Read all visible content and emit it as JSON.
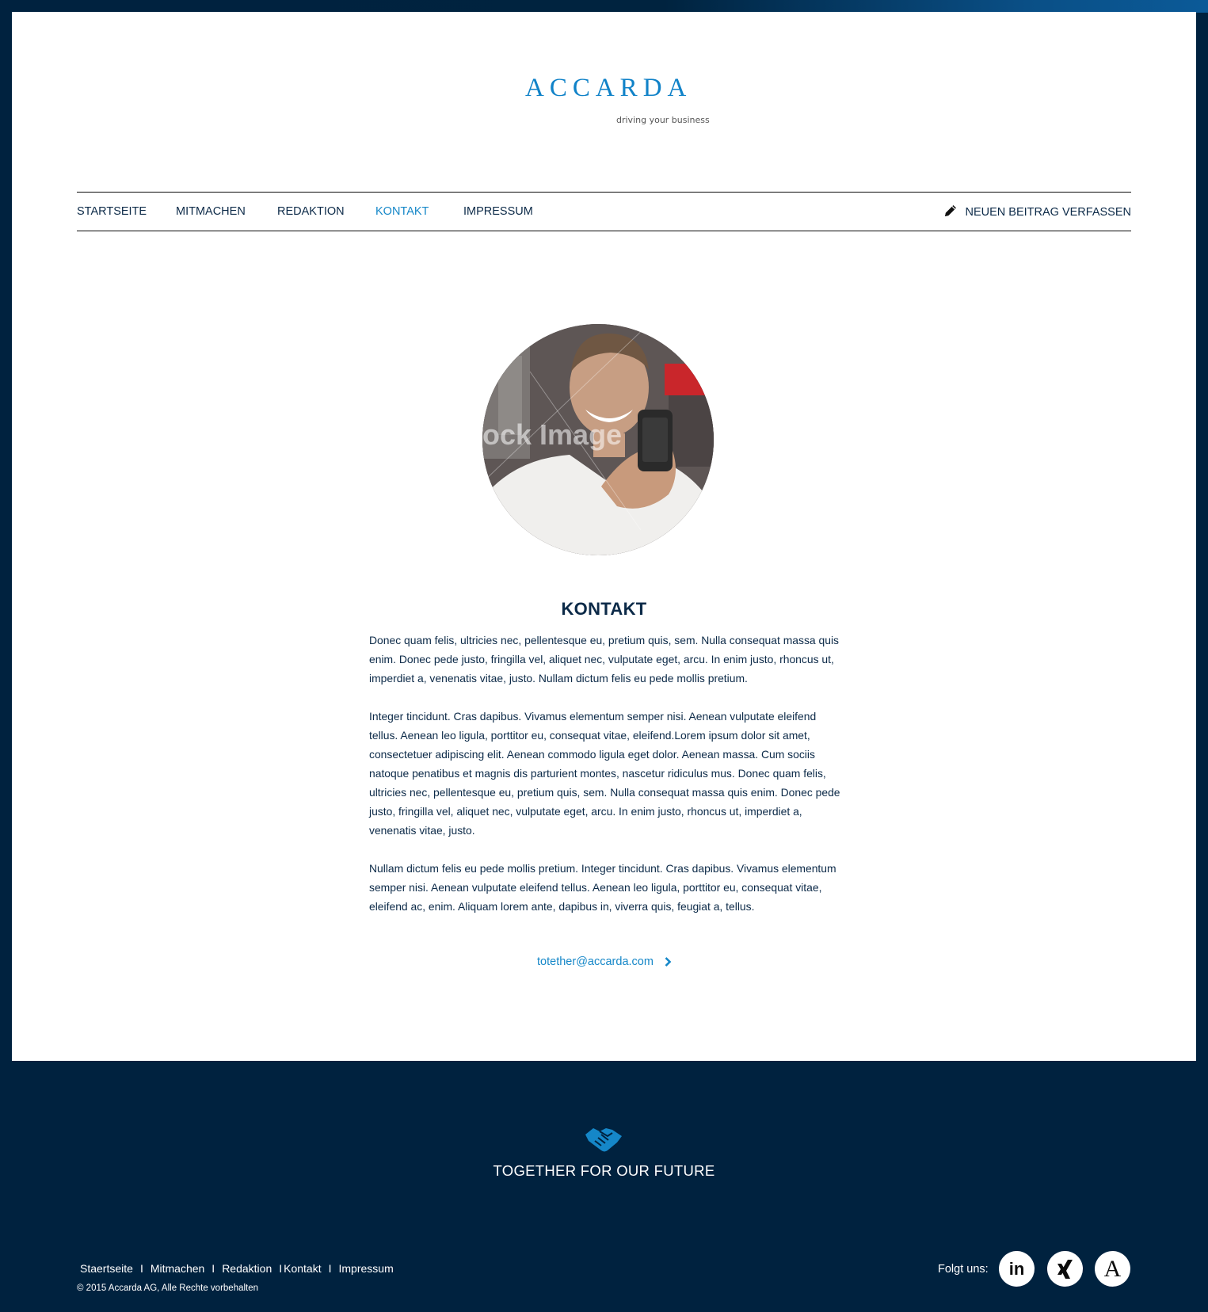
{
  "brand": {
    "name": "ACCARDA",
    "tagline": "driving your business"
  },
  "nav": {
    "items": [
      {
        "label": "STARTSEITE"
      },
      {
        "label": "MITMACHEN"
      },
      {
        "label": "REDAKTION"
      },
      {
        "label": "KONTAKT",
        "active": true
      },
      {
        "label": "IMPRESSUM"
      }
    ],
    "write_label": "NEUEN BEITRAG VERFASSEN"
  },
  "hero": {
    "watermark": "ock Image"
  },
  "main": {
    "heading": "KONTAKT",
    "paragraphs": [
      "Donec quam felis, ultricies nec, pellentesque eu, pretium quis, sem. Nulla consequat massa quis enim. Donec pede justo, fringilla vel, aliquet nec, vulputate eget, arcu. In enim justo, rhoncus ut, imperdiet a, venenatis vitae, justo. Nullam dictum felis eu pede mollis pretium.",
      "Integer tincidunt. Cras dapibus. Vivamus elementum semper nisi. Aenean vulputate eleifend tellus. Aenean leo ligula, porttitor eu, consequat vitae, eleifend.Lorem ipsum dolor sit amet, consectetuer adipiscing elit. Aenean commodo ligula eget dolor. Aenean massa. Cum sociis natoque penatibus et magnis dis parturient montes, nascetur ridiculus mus. Donec quam felis, ultricies nec, pellentesque eu, pretium quis, sem. Nulla consequat massa quis enim. Donec pede justo, fringilla vel, aliquet nec, vulputate eget, arcu. In enim justo, rhoncus ut, imperdiet a, venenatis vitae, justo.",
      "Nullam dictum felis eu pede mollis pretium. Integer tincidunt. Cras dapibus. Vivamus elementum semper nisi. Aenean vulputate eleifend tellus. Aenean leo ligula, porttitor eu, consequat vitae, eleifend ac, enim. Aliquam lorem ante, dapibus in, viverra quis, feugiat a, tellus."
    ],
    "email": "totether@accarda.com"
  },
  "footer": {
    "tagline": "TOGETHER FOR OUR FUTURE",
    "links": [
      {
        "label": "Staertseite"
      },
      {
        "label": "Mitmachen"
      },
      {
        "label": "Redaktion"
      },
      {
        "label": "Kontakt"
      },
      {
        "label": "Impressum"
      }
    ],
    "separator": "I",
    "copyright": "© 2015 Accarda AG, Alle Rechte vorbehalten",
    "follow_label": "Folgt uns:",
    "social": [
      {
        "icon": "linkedin-icon",
        "glyph": "in"
      },
      {
        "icon": "xing-icon"
      },
      {
        "icon": "a-icon",
        "glyph": "A"
      }
    ]
  },
  "colors": {
    "accent": "#1587c8",
    "dark": "#00223f",
    "text": "#0c2a48"
  }
}
